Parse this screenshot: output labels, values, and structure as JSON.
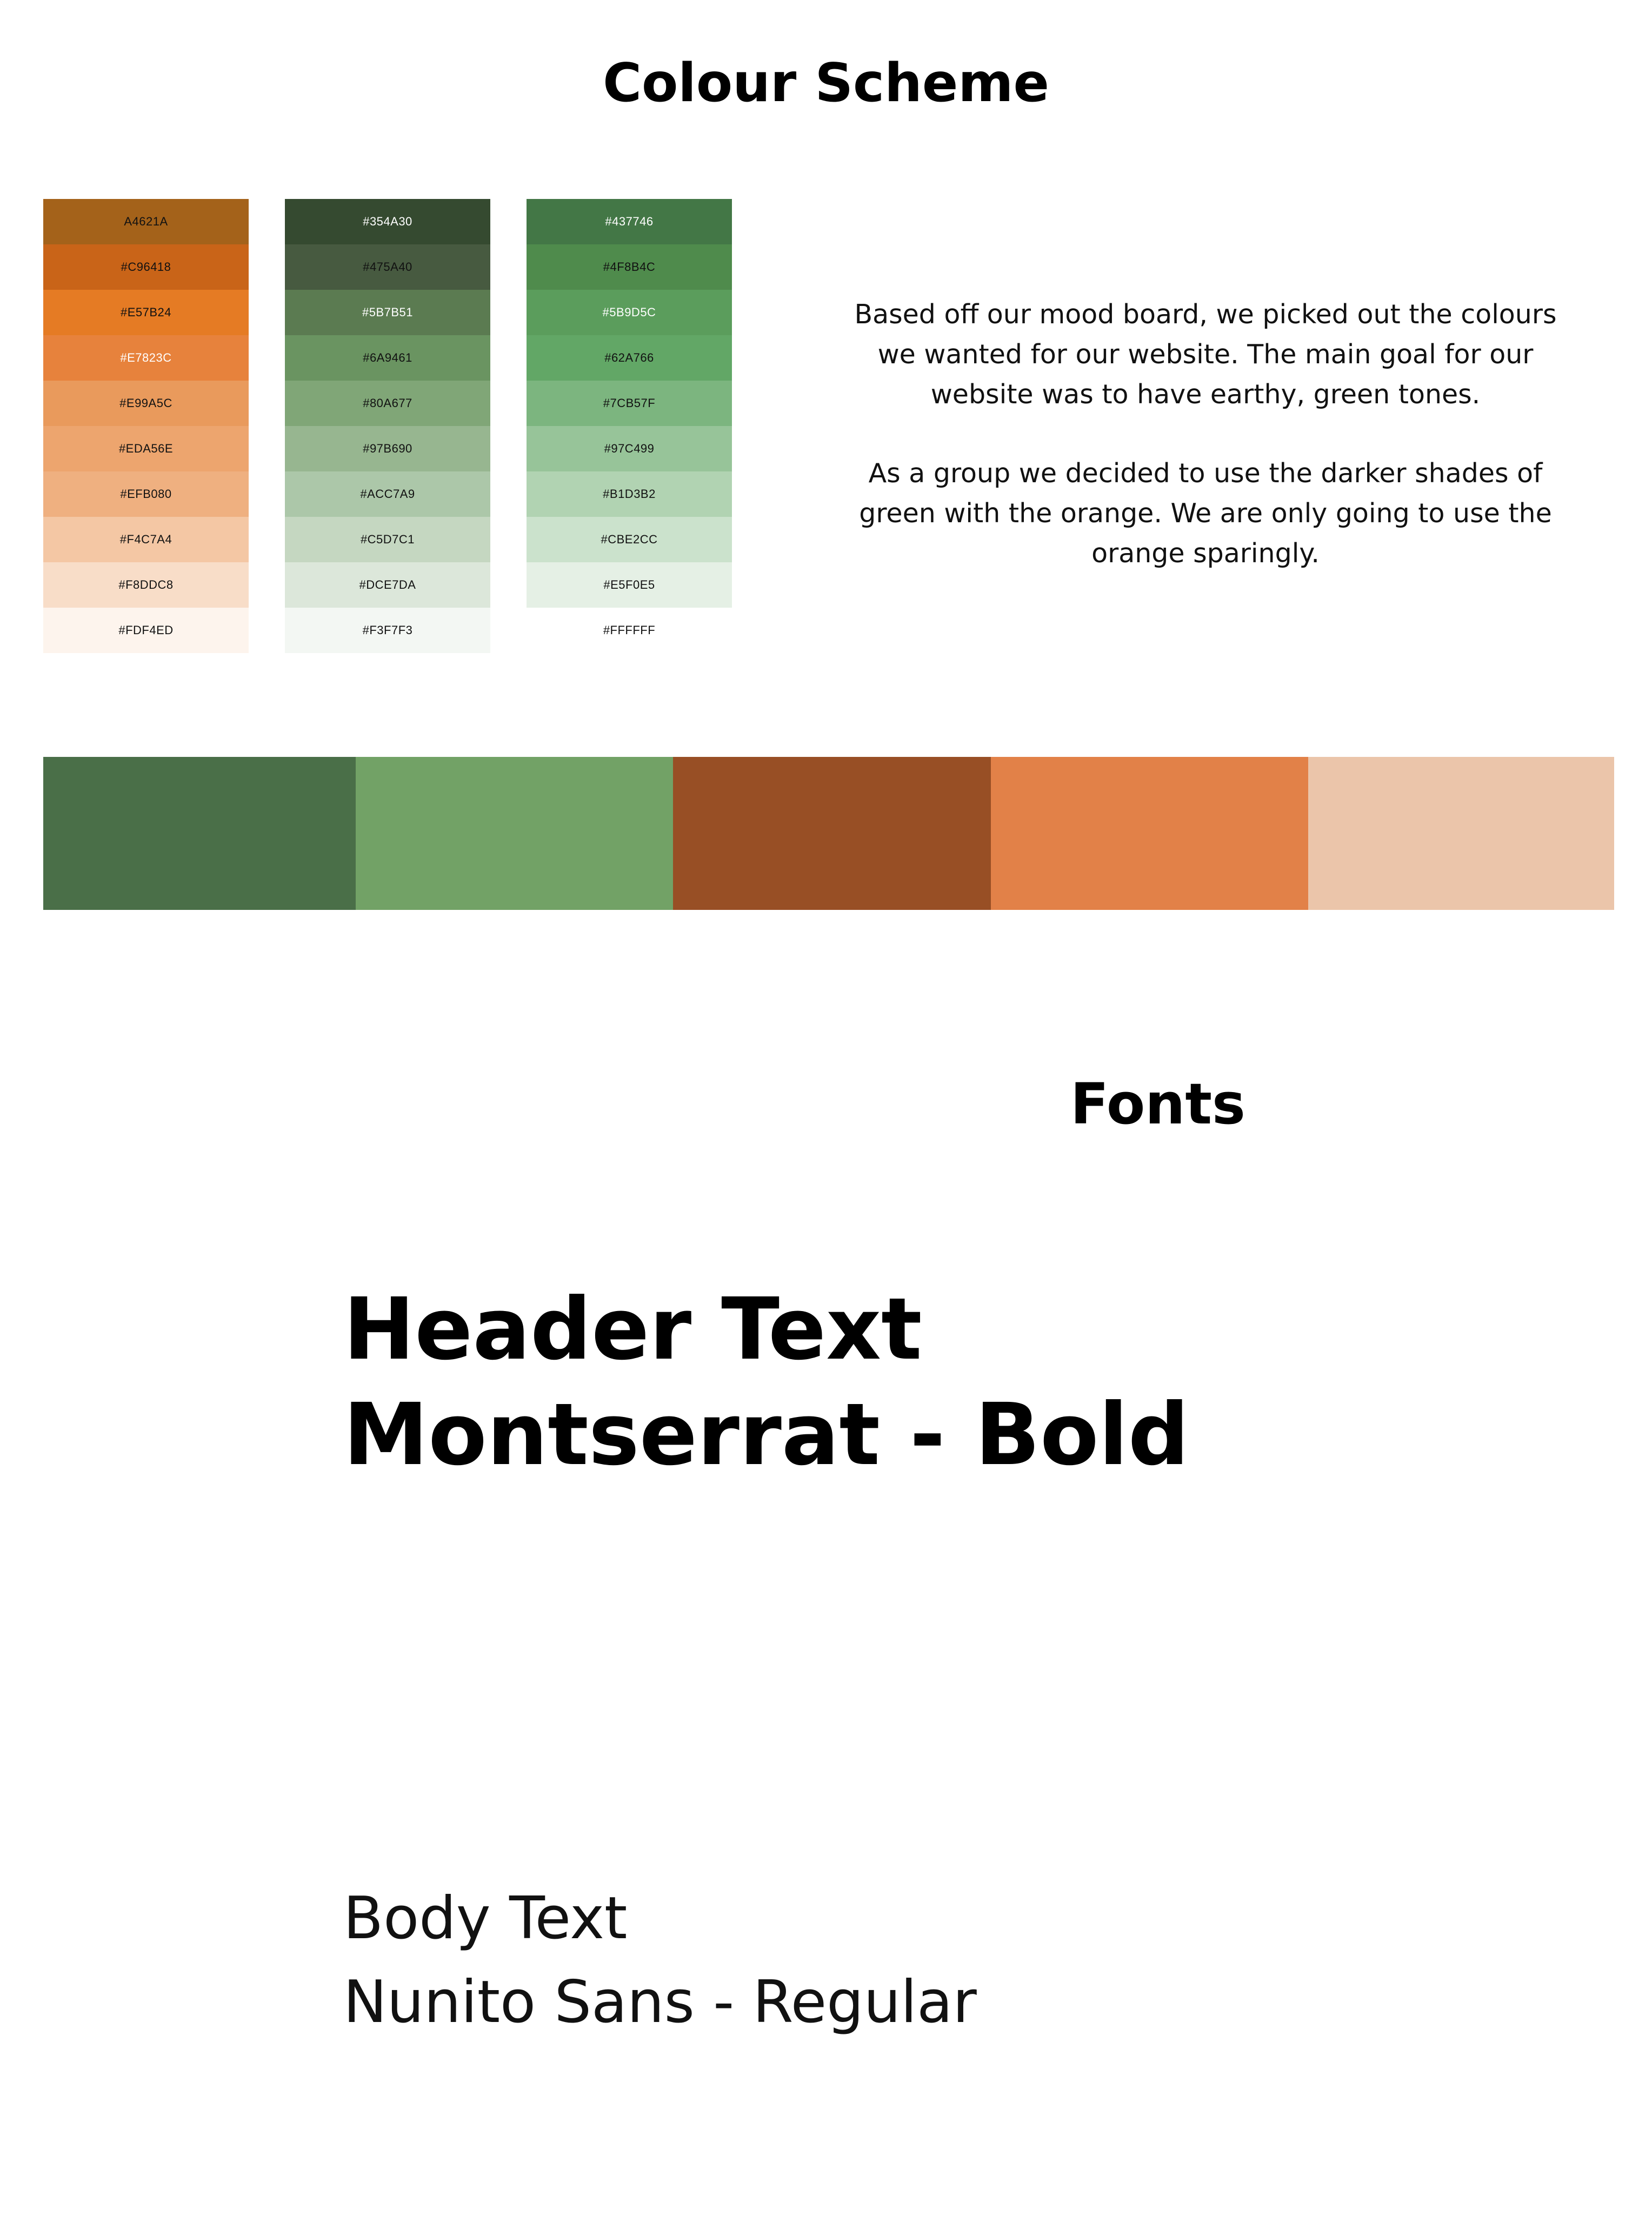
{
  "colour_scheme": {
    "title": "Colour Scheme",
    "palettes": [
      {
        "swatches": [
          {
            "label": "A4621A",
            "color": "#A4621A",
            "text_color": "#111111"
          },
          {
            "label": "#C96418",
            "color": "#C96418",
            "text_color": "#111111"
          },
          {
            "label": "#E57B24",
            "color": "#E57B24",
            "text_color": "#111111"
          },
          {
            "label": "#E7823C",
            "color": "#E7823C",
            "text_color": "#ffffff"
          },
          {
            "label": "#E99A5C",
            "color": "#E99A5C",
            "text_color": "#111111"
          },
          {
            "label": "#EDA56E",
            "color": "#EDA56E",
            "text_color": "#111111"
          },
          {
            "label": "#EFB080",
            "color": "#EFB080",
            "text_color": "#111111"
          },
          {
            "label": "#F4C7A4",
            "color": "#F4C7A4",
            "text_color": "#111111"
          },
          {
            "label": "#F8DDC8",
            "color": "#F8DDC8",
            "text_color": "#111111"
          },
          {
            "label": "#FDF4ED",
            "color": "#FDF4ED",
            "text_color": "#111111"
          }
        ]
      },
      {
        "swatches": [
          {
            "label": "#354A30",
            "color": "#354A30",
            "text_color": "#ffffff"
          },
          {
            "label": "#475A40",
            "color": "#475A40",
            "text_color": "#111111"
          },
          {
            "label": "#5B7B51",
            "color": "#5B7B51",
            "text_color": "#ffffff"
          },
          {
            "label": "#6A9461",
            "color": "#6A9461",
            "text_color": "#111111"
          },
          {
            "label": "#80A677",
            "color": "#80A677",
            "text_color": "#111111"
          },
          {
            "label": "#97B690",
            "color": "#97B690",
            "text_color": "#111111"
          },
          {
            "label": "#ACC7A9",
            "color": "#ACC7A9",
            "text_color": "#111111"
          },
          {
            "label": "#C5D7C1",
            "color": "#C5D7C1",
            "text_color": "#111111"
          },
          {
            "label": "#DCE7DA",
            "color": "#DCE7DA",
            "text_color": "#111111"
          },
          {
            "label": "#F3F7F3",
            "color": "#F3F7F3",
            "text_color": "#111111"
          }
        ]
      },
      {
        "swatches": [
          {
            "label": "#437746",
            "color": "#437746",
            "text_color": "#ffffff"
          },
          {
            "label": "#4F8B4C",
            "color": "#4F8B4C",
            "text_color": "#111111"
          },
          {
            "label": "#5B9D5C",
            "color": "#5B9D5C",
            "text_color": "#ffffff"
          },
          {
            "label": "#62A766",
            "color": "#62A766",
            "text_color": "#111111"
          },
          {
            "label": "#7CB57F",
            "color": "#7CB57F",
            "text_color": "#111111"
          },
          {
            "label": "#97C499",
            "color": "#97C499",
            "text_color": "#111111"
          },
          {
            "label": "#B1D3B2",
            "color": "#B1D3B2",
            "text_color": "#111111"
          },
          {
            "label": "#CBE2CC",
            "color": "#CBE2CC",
            "text_color": "#111111"
          },
          {
            "label": "#E5F0E5",
            "color": "#E5F0E5",
            "text_color": "#111111"
          },
          {
            "label": "#FFFFFF",
            "color": "#FFFFFF",
            "text_color": "#111111"
          }
        ]
      }
    ],
    "description": [
      "Based off our mood board, we picked out the colours we wanted for our website. The main goal for our website was to have earthy, green tones.",
      "As a group we decided to use the darker shades of green with the orange. We are only going to use the orange sparingly."
    ],
    "selected_colors": [
      "#4A6F48",
      "#72A266",
      "#984F25",
      "#E28148",
      "#EBC5AA"
    ]
  },
  "fonts": {
    "title": "Fonts",
    "header_sample_line1": "Header Text",
    "header_sample_line2": "Montserrat - Bold",
    "body_sample_line1": "Body Text",
    "body_sample_line2": "Nunito Sans - Regular"
  }
}
